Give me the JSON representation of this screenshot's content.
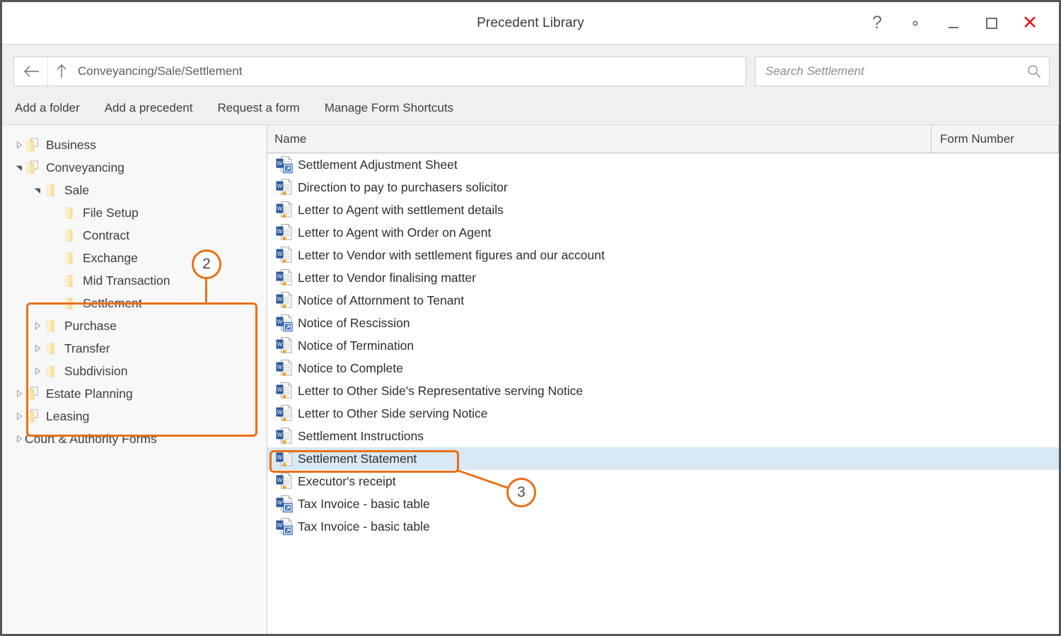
{
  "window": {
    "title": "Precedent Library",
    "controls": [
      {
        "name": "help",
        "glyph": "?"
      },
      {
        "name": "settings",
        "glyph": "gear"
      },
      {
        "name": "minimize",
        "glyph": "minimize"
      },
      {
        "name": "maximize",
        "glyph": "maximize"
      },
      {
        "name": "close",
        "glyph": "close"
      }
    ],
    "close_color": "#e01b1b"
  },
  "nav": {
    "back_icon": "back-arrow-icon",
    "up_icon": "up-arrow-icon",
    "path": "Conveyancing/Sale/Settlement",
    "search_placeholder": "Search Settlement",
    "search_value": "",
    "search_icon": "search-icon"
  },
  "toolbar": {
    "items": [
      {
        "label": "Add a folder"
      },
      {
        "label": "Add a precedent"
      },
      {
        "label": "Request a form"
      },
      {
        "label": "Manage Form Shortcuts"
      }
    ]
  },
  "tree": {
    "nodes": [
      {
        "label": "Business",
        "depth": 0,
        "chevron": "collapsed",
        "icon": "folder-document-icon",
        "selected": false
      },
      {
        "label": "Conveyancing",
        "depth": 0,
        "chevron": "expanded",
        "icon": "folder-document-icon",
        "selected": false
      },
      {
        "label": "Sale",
        "depth": 1,
        "chevron": "expanded",
        "icon": "folder-icon",
        "selected": false
      },
      {
        "label": "File Setup",
        "depth": 2,
        "chevron": "none",
        "icon": "folder-icon",
        "selected": false
      },
      {
        "label": "Contract",
        "depth": 2,
        "chevron": "none",
        "icon": "folder-icon",
        "selected": false
      },
      {
        "label": "Exchange",
        "depth": 2,
        "chevron": "none",
        "icon": "folder-icon",
        "selected": false
      },
      {
        "label": "Mid Transaction",
        "depth": 2,
        "chevron": "none",
        "icon": "folder-icon",
        "selected": false
      },
      {
        "label": "Settlement",
        "depth": 2,
        "chevron": "none",
        "icon": "folder-icon",
        "selected": true
      },
      {
        "label": "Purchase",
        "depth": 1,
        "chevron": "collapsed",
        "icon": "folder-icon",
        "selected": false
      },
      {
        "label": "Transfer",
        "depth": 1,
        "chevron": "collapsed",
        "icon": "folder-icon",
        "selected": false
      },
      {
        "label": "Subdivision",
        "depth": 1,
        "chevron": "collapsed",
        "icon": "folder-icon",
        "selected": false
      },
      {
        "label": "Estate Planning",
        "depth": 0,
        "chevron": "collapsed",
        "icon": "folder-document-icon",
        "selected": false
      },
      {
        "label": "Leasing",
        "depth": 0,
        "chevron": "collapsed",
        "icon": "folder-document-icon",
        "selected": false
      },
      {
        "label": "Court & Authority Forms",
        "depth": 0,
        "chevron": "collapsed",
        "icon": "none",
        "selected": false
      }
    ]
  },
  "list": {
    "columns": [
      {
        "label": "Name"
      },
      {
        "label": "Form Number"
      }
    ],
    "rows": [
      {
        "name": "Settlement Adjustment Sheet",
        "form_number": "",
        "icon": "word-shortcut-icon",
        "selected": false
      },
      {
        "name": "Direction to pay to purchasers solicitor",
        "form_number": "",
        "icon": "word-precedent-icon",
        "selected": false
      },
      {
        "name": "Letter to Agent with settlement details",
        "form_number": "",
        "icon": "word-precedent-icon",
        "selected": false
      },
      {
        "name": "Letter to Agent with Order on Agent",
        "form_number": "",
        "icon": "word-precedent-icon",
        "selected": false
      },
      {
        "name": "Letter to Vendor with settlement figures and our account",
        "form_number": "",
        "icon": "word-precedent-icon",
        "selected": false
      },
      {
        "name": "Letter to Vendor finalising matter",
        "form_number": "",
        "icon": "word-precedent-icon",
        "selected": false
      },
      {
        "name": "Notice of Attornment to Tenant",
        "form_number": "",
        "icon": "word-precedent-icon",
        "selected": false
      },
      {
        "name": "Notice of Rescission",
        "form_number": "",
        "icon": "word-shortcut-icon",
        "selected": false
      },
      {
        "name": "Notice of Termination",
        "form_number": "",
        "icon": "word-precedent-icon",
        "selected": false
      },
      {
        "name": "Notice to Complete",
        "form_number": "",
        "icon": "word-precedent-icon",
        "selected": false
      },
      {
        "name": "Letter to Other Side's Representative serving Notice",
        "form_number": "",
        "icon": "word-precedent-icon",
        "selected": false
      },
      {
        "name": "Letter to Other Side serving Notice",
        "form_number": "",
        "icon": "word-precedent-icon",
        "selected": false
      },
      {
        "name": "Settlement Instructions",
        "form_number": "",
        "icon": "word-precedent-icon",
        "selected": false
      },
      {
        "name": "Settlement Statement",
        "form_number": "",
        "icon": "word-precedent-icon",
        "selected": true
      },
      {
        "name": "Executor's receipt",
        "form_number": "",
        "icon": "word-precedent-icon",
        "selected": false
      },
      {
        "name": "Tax Invoice - basic table",
        "form_number": "",
        "icon": "word-shortcut-icon",
        "selected": false
      },
      {
        "name": "Tax Invoice - basic table",
        "form_number": "",
        "icon": "word-shortcut-icon",
        "selected": false
      }
    ]
  },
  "annotations": {
    "accent_color": "#e8701a",
    "callouts": [
      {
        "number": "2",
        "target": "tree-sale-branch"
      },
      {
        "number": "3",
        "target": "list-row-settlement-statement"
      }
    ]
  }
}
